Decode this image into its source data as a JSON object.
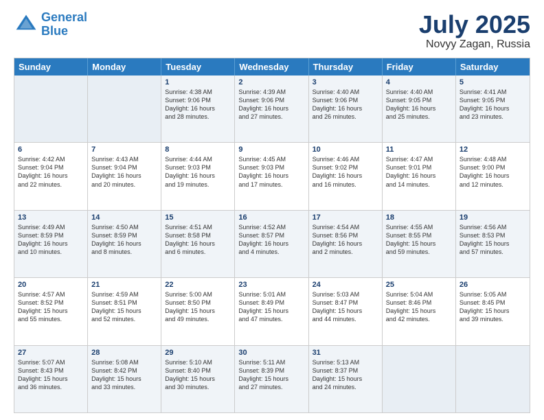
{
  "logo": {
    "line1": "General",
    "line2": "Blue"
  },
  "title": {
    "month": "July 2025",
    "location": "Novyy Zagan, Russia"
  },
  "headers": [
    "Sunday",
    "Monday",
    "Tuesday",
    "Wednesday",
    "Thursday",
    "Friday",
    "Saturday"
  ],
  "rows": [
    [
      {
        "day": "",
        "text": ""
      },
      {
        "day": "",
        "text": ""
      },
      {
        "day": "1",
        "text": "Sunrise: 4:38 AM\nSunset: 9:06 PM\nDaylight: 16 hours\nand 28 minutes."
      },
      {
        "day": "2",
        "text": "Sunrise: 4:39 AM\nSunset: 9:06 PM\nDaylight: 16 hours\nand 27 minutes."
      },
      {
        "day": "3",
        "text": "Sunrise: 4:40 AM\nSunset: 9:06 PM\nDaylight: 16 hours\nand 26 minutes."
      },
      {
        "day": "4",
        "text": "Sunrise: 4:40 AM\nSunset: 9:05 PM\nDaylight: 16 hours\nand 25 minutes."
      },
      {
        "day": "5",
        "text": "Sunrise: 4:41 AM\nSunset: 9:05 PM\nDaylight: 16 hours\nand 23 minutes."
      }
    ],
    [
      {
        "day": "6",
        "text": "Sunrise: 4:42 AM\nSunset: 9:04 PM\nDaylight: 16 hours\nand 22 minutes."
      },
      {
        "day": "7",
        "text": "Sunrise: 4:43 AM\nSunset: 9:04 PM\nDaylight: 16 hours\nand 20 minutes."
      },
      {
        "day": "8",
        "text": "Sunrise: 4:44 AM\nSunset: 9:03 PM\nDaylight: 16 hours\nand 19 minutes."
      },
      {
        "day": "9",
        "text": "Sunrise: 4:45 AM\nSunset: 9:03 PM\nDaylight: 16 hours\nand 17 minutes."
      },
      {
        "day": "10",
        "text": "Sunrise: 4:46 AM\nSunset: 9:02 PM\nDaylight: 16 hours\nand 16 minutes."
      },
      {
        "day": "11",
        "text": "Sunrise: 4:47 AM\nSunset: 9:01 PM\nDaylight: 16 hours\nand 14 minutes."
      },
      {
        "day": "12",
        "text": "Sunrise: 4:48 AM\nSunset: 9:00 PM\nDaylight: 16 hours\nand 12 minutes."
      }
    ],
    [
      {
        "day": "13",
        "text": "Sunrise: 4:49 AM\nSunset: 8:59 PM\nDaylight: 16 hours\nand 10 minutes."
      },
      {
        "day": "14",
        "text": "Sunrise: 4:50 AM\nSunset: 8:59 PM\nDaylight: 16 hours\nand 8 minutes."
      },
      {
        "day": "15",
        "text": "Sunrise: 4:51 AM\nSunset: 8:58 PM\nDaylight: 16 hours\nand 6 minutes."
      },
      {
        "day": "16",
        "text": "Sunrise: 4:52 AM\nSunset: 8:57 PM\nDaylight: 16 hours\nand 4 minutes."
      },
      {
        "day": "17",
        "text": "Sunrise: 4:54 AM\nSunset: 8:56 PM\nDaylight: 16 hours\nand 2 minutes."
      },
      {
        "day": "18",
        "text": "Sunrise: 4:55 AM\nSunset: 8:55 PM\nDaylight: 15 hours\nand 59 minutes."
      },
      {
        "day": "19",
        "text": "Sunrise: 4:56 AM\nSunset: 8:53 PM\nDaylight: 15 hours\nand 57 minutes."
      }
    ],
    [
      {
        "day": "20",
        "text": "Sunrise: 4:57 AM\nSunset: 8:52 PM\nDaylight: 15 hours\nand 55 minutes."
      },
      {
        "day": "21",
        "text": "Sunrise: 4:59 AM\nSunset: 8:51 PM\nDaylight: 15 hours\nand 52 minutes."
      },
      {
        "day": "22",
        "text": "Sunrise: 5:00 AM\nSunset: 8:50 PM\nDaylight: 15 hours\nand 49 minutes."
      },
      {
        "day": "23",
        "text": "Sunrise: 5:01 AM\nSunset: 8:49 PM\nDaylight: 15 hours\nand 47 minutes."
      },
      {
        "day": "24",
        "text": "Sunrise: 5:03 AM\nSunset: 8:47 PM\nDaylight: 15 hours\nand 44 minutes."
      },
      {
        "day": "25",
        "text": "Sunrise: 5:04 AM\nSunset: 8:46 PM\nDaylight: 15 hours\nand 42 minutes."
      },
      {
        "day": "26",
        "text": "Sunrise: 5:05 AM\nSunset: 8:45 PM\nDaylight: 15 hours\nand 39 minutes."
      }
    ],
    [
      {
        "day": "27",
        "text": "Sunrise: 5:07 AM\nSunset: 8:43 PM\nDaylight: 15 hours\nand 36 minutes."
      },
      {
        "day": "28",
        "text": "Sunrise: 5:08 AM\nSunset: 8:42 PM\nDaylight: 15 hours\nand 33 minutes."
      },
      {
        "day": "29",
        "text": "Sunrise: 5:10 AM\nSunset: 8:40 PM\nDaylight: 15 hours\nand 30 minutes."
      },
      {
        "day": "30",
        "text": "Sunrise: 5:11 AM\nSunset: 8:39 PM\nDaylight: 15 hours\nand 27 minutes."
      },
      {
        "day": "31",
        "text": "Sunrise: 5:13 AM\nSunset: 8:37 PM\nDaylight: 15 hours\nand 24 minutes."
      },
      {
        "day": "",
        "text": ""
      },
      {
        "day": "",
        "text": ""
      }
    ]
  ],
  "alt_rows": [
    0,
    2,
    4
  ]
}
